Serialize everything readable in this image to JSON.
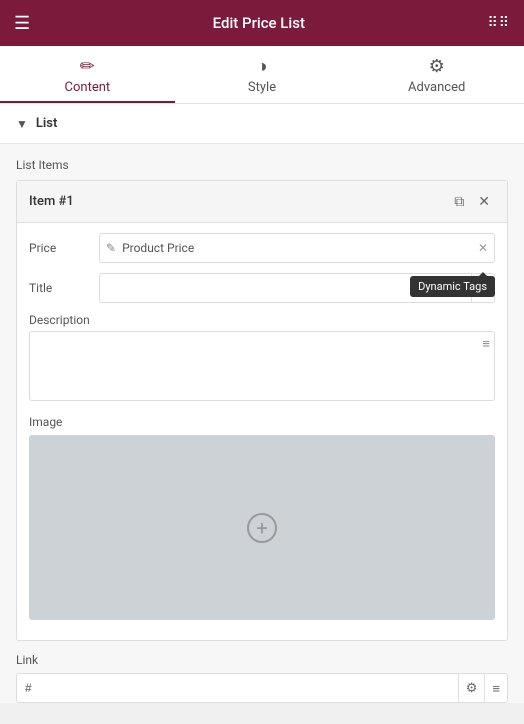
{
  "header": {
    "title": "Edit Price List",
    "menu_icon": "≡",
    "grid_icon": "⋮⋮⋮"
  },
  "tabs": [
    {
      "id": "content",
      "label": "Content",
      "icon": "✏",
      "active": true
    },
    {
      "id": "style",
      "label": "Style",
      "icon": "◑",
      "active": false
    },
    {
      "id": "advanced",
      "label": "Advanced",
      "icon": "⚙",
      "active": false
    }
  ],
  "section": {
    "label": "List",
    "toggle_icon": "▼"
  },
  "list_items": {
    "label": "List Items",
    "item": {
      "title": "Item #1",
      "price": {
        "label": "Price",
        "value": "Product Price",
        "icon": "✎"
      },
      "title_field": {
        "label": "Title",
        "placeholder": "",
        "value": ""
      },
      "description": {
        "label": "Description",
        "placeholder": "",
        "value": ""
      },
      "image": {
        "label": "Image"
      },
      "dynamic_tags_tooltip": "Dynamic Tags"
    }
  },
  "link": {
    "label": "Link",
    "placeholder": "#",
    "value": "#"
  },
  "icons": {
    "menu": "☰",
    "grid": "⠿",
    "pencil": "✎",
    "copy": "⧉",
    "close": "✕",
    "gear": "⚙",
    "list": "≡",
    "plus": "+",
    "chevron_down": "▼",
    "tag": "⊞"
  }
}
